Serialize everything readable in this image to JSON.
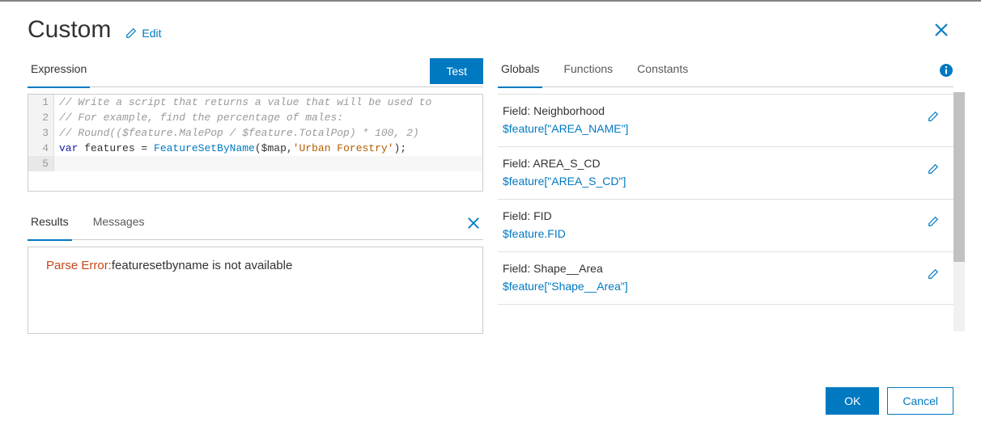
{
  "title": "Custom",
  "edit_label": "Edit",
  "left_tabs": {
    "expression": "Expression"
  },
  "test_label": "Test",
  "code": {
    "line1": "// Write a script that returns a value that will be used to",
    "line2": "// For example, find the percentage of males:",
    "line3": "// Round(($feature.MalePop / $feature.TotalPop) * 100, 2)",
    "line4_kw": "var",
    "line4_mid": " features = ",
    "line4_fn": "FeatureSetByName",
    "line4_paren_open": "(",
    "line4_arg1": "$map,",
    "line4_str": "'Urban Forestry'",
    "line4_paren_close": ");",
    "line5": ""
  },
  "result_tabs": {
    "results": "Results",
    "messages": "Messages"
  },
  "result": {
    "error_label": "Parse Error:",
    "error_msg": "featuresetbyname is not available"
  },
  "right_tabs": {
    "globals": "Globals",
    "functions": "Functions",
    "constants": "Constants"
  },
  "globals": [
    {
      "field_label": "Field: Neighborhood",
      "expr": "$feature[\"AREA_NAME\"]"
    },
    {
      "field_label": "Field: AREA_S_CD",
      "expr": "$feature[\"AREA_S_CD\"]"
    },
    {
      "field_label": "Field: FID",
      "expr": "$feature.FID"
    },
    {
      "field_label": "Field: Shape__Area",
      "expr": "$feature[\"Shape__Area\"]"
    }
  ],
  "ok_label": "OK",
  "cancel_label": "Cancel"
}
